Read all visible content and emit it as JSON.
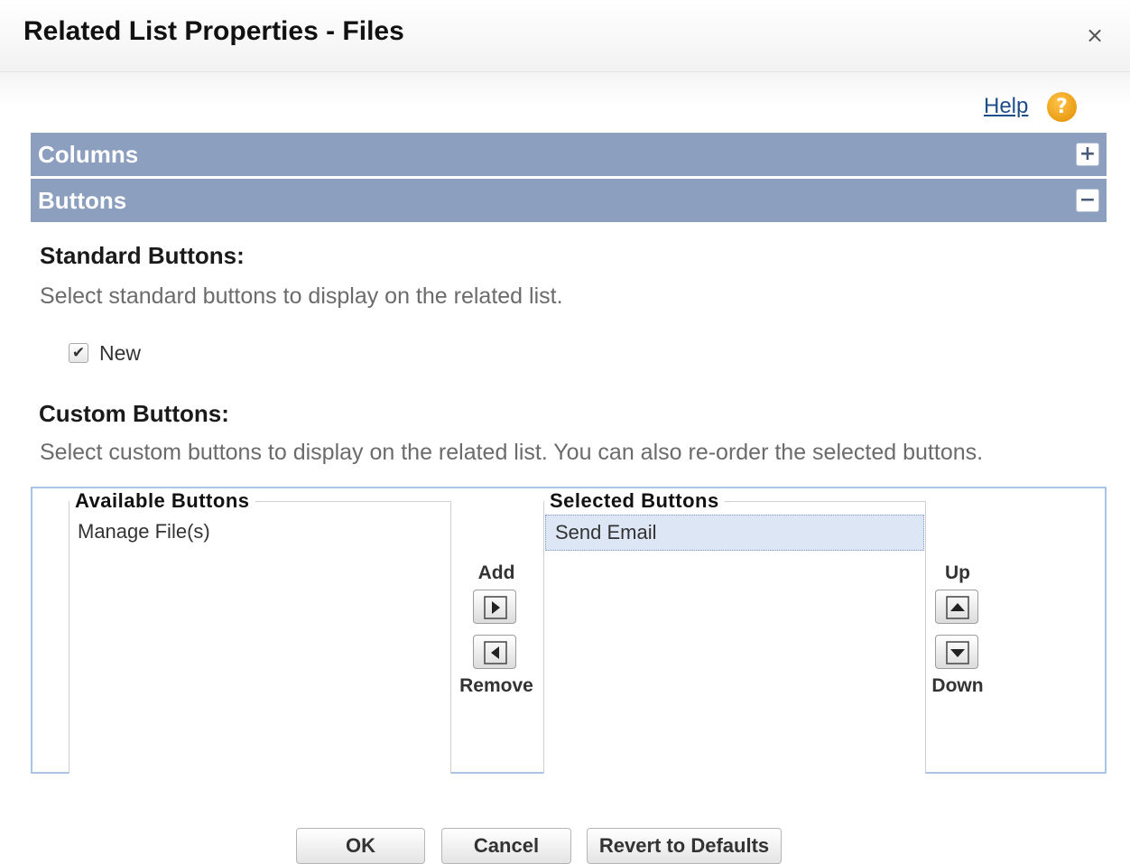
{
  "dialog": {
    "title": "Related List Properties - Files",
    "close_symbol": "×",
    "help_label": "Help",
    "help_icon": "?"
  },
  "sections": {
    "columns": {
      "label": "Columns",
      "toggle": "+"
    },
    "buttons": {
      "label": "Buttons",
      "toggle": "−"
    }
  },
  "standard_buttons": {
    "heading": "Standard Buttons:",
    "description": "Select standard buttons to display on the related list.",
    "options": [
      {
        "label": "New",
        "checked": true,
        "check_mark": "✔"
      }
    ]
  },
  "custom_buttons": {
    "heading": "Custom Buttons:",
    "description": "Select custom buttons to display on the related list. You can also re-order the selected buttons.",
    "available": {
      "title": "Available Buttons",
      "items": [
        "Manage File(s)"
      ]
    },
    "selected": {
      "title": "Selected Buttons",
      "items": [
        "Send Email"
      ]
    },
    "controls": {
      "add_label": "Add",
      "remove_label": "Remove",
      "up_label": "Up",
      "down_label": "Down"
    }
  },
  "footer": {
    "ok_label": "OK",
    "cancel_label": "Cancel",
    "revert_label": "Revert to Defaults"
  },
  "colors": {
    "section_header": "#8d9fbf",
    "link": "#1f4d8a",
    "help_icon": "#f0a21a",
    "list_border": "#a9c4e6",
    "selected_item": "#dde6f4"
  }
}
